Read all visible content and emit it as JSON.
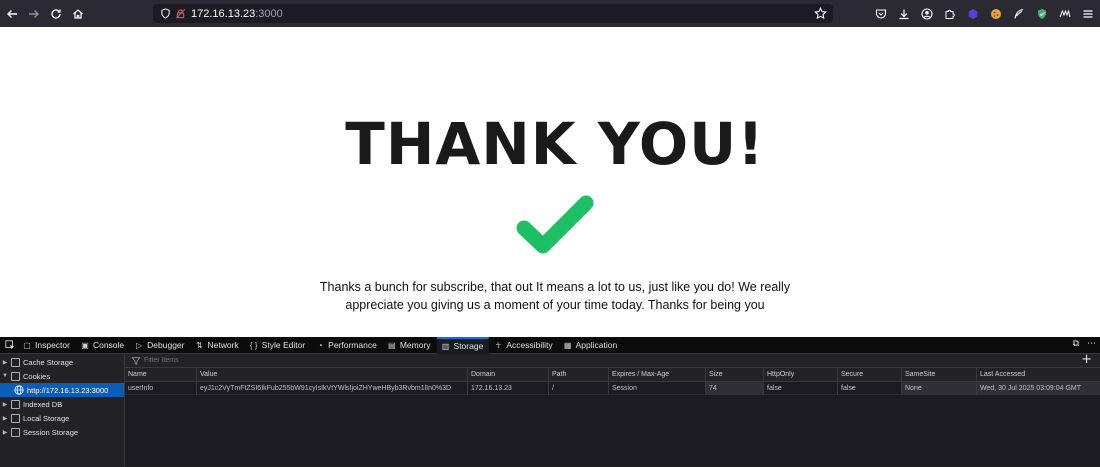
{
  "browser": {
    "url_host": "172.16.13.23",
    "url_port": ":3000"
  },
  "page": {
    "title": "THANK YOU!",
    "message": "Thanks a bunch for subscribe, that out It means a lot to us, just like you do! We really appreciate you giving us a moment of your time today. Thanks for being you",
    "check_color": "#1dbf65"
  },
  "devtools": {
    "tabs": [
      {
        "label": "Inspector",
        "icon": "inspector-icon"
      },
      {
        "label": "Console",
        "icon": "console-icon"
      },
      {
        "label": "Debugger",
        "icon": "debugger-icon"
      },
      {
        "label": "Network",
        "icon": "network-icon"
      },
      {
        "label": "Style Editor",
        "icon": "style-editor-icon"
      },
      {
        "label": "Performance",
        "icon": "performance-icon"
      },
      {
        "label": "Memory",
        "icon": "memory-icon"
      },
      {
        "label": "Storage",
        "icon": "storage-icon",
        "active": true
      },
      {
        "label": "Accessibility",
        "icon": "accessibility-icon"
      },
      {
        "label": "Application",
        "icon": "application-icon"
      }
    ],
    "tree": {
      "cache_storage": "Cache Storage",
      "cookies": "Cookies",
      "cookie_host": "http://172.16.13.23:3000",
      "indexed_db": "Indexed DB",
      "local_storage": "Local Storage",
      "session_storage": "Session Storage"
    },
    "filter_placeholder": "Filter Items",
    "columns": [
      "Name",
      "Value",
      "Domain",
      "Path",
      "Expires / Max-Age",
      "Size",
      "HttpOnly",
      "Secure",
      "SameSite",
      "Last Accessed"
    ],
    "rows": [
      [
        "userInfo",
        "eyJ1c2VyTmFtZSI6IkFub255bW91cyIsIkVtYWlsIjoiZHYweHByb3Rvbm1lIn0%3D",
        "172.16.13.23",
        "/",
        "Session",
        "74",
        "false",
        "false",
        "None",
        "Wed, 30 Jul 2025 03:09:04 GMT"
      ]
    ]
  }
}
